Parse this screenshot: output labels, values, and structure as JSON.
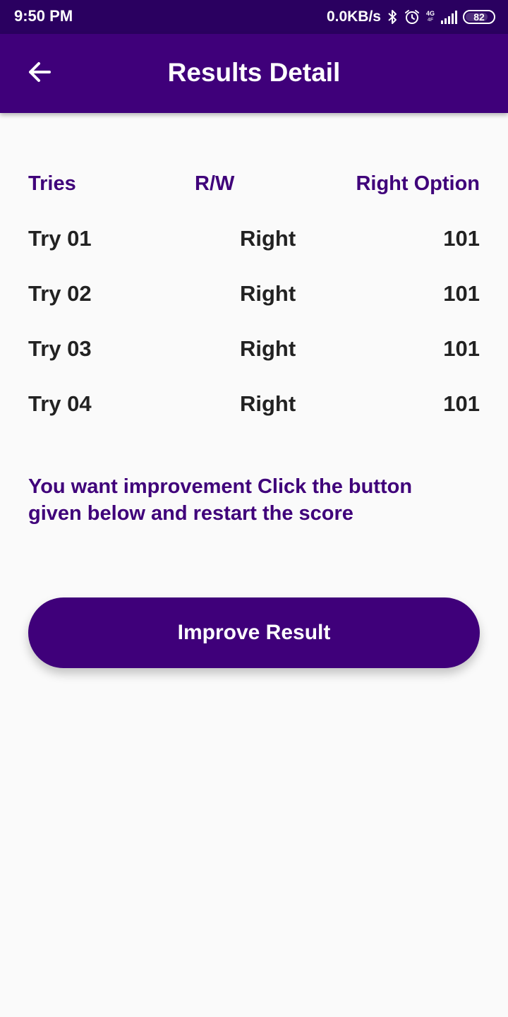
{
  "status_bar": {
    "time": "9:50 PM",
    "net_speed": "0.0KB/s",
    "network_type": "4G",
    "network_sub": "4F",
    "battery": "82",
    "battery_level": 0.82,
    "icons": [
      "bluetooth-icon",
      "alarm-icon",
      "signal-icon",
      "battery-icon"
    ]
  },
  "app_bar": {
    "title": "Results Detail",
    "back_icon": "arrow-left-icon",
    "color": "#3f007a"
  },
  "table": {
    "headers": {
      "tries": "Tries",
      "rw": "R/W",
      "option": "Right Option"
    },
    "rows": [
      {
        "tries": "Try 01",
        "rw": "Right",
        "option": "101"
      },
      {
        "tries": "Try 02",
        "rw": "Right",
        "option": "101"
      },
      {
        "tries": "Try 03",
        "rw": "Right",
        "option": "101"
      },
      {
        "tries": "Try 04",
        "rw": "Right",
        "option": "101"
      }
    ]
  },
  "note": "You want improvement Click the button given below and restart the score",
  "improve_button": {
    "label": "Improve Result"
  },
  "colors": {
    "primary": "#3f007a",
    "status_bar": "#2a0060",
    "background": "#fafafa",
    "text": "#222222"
  }
}
